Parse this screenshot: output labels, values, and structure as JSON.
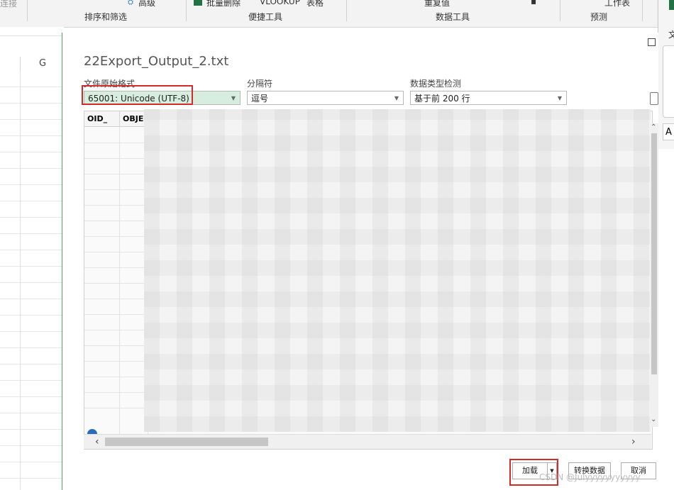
{
  "ribbon": {
    "frag_connect": "连接",
    "frag_advanced": "高级",
    "frag_batch_delete": "批量删除 ",
    "frag_vlookup": "VLOOKUP",
    "frag_table": "表格",
    "frag_reorg": "重复值",
    "frag_cut": "工作表",
    "group_sort_filter": "排序和筛选",
    "group_quick_tools": "便捷工具",
    "group_data_tools": "数据工具",
    "group_forecast": "预测"
  },
  "sheet": {
    "column_g": "G"
  },
  "dialog": {
    "title": "22Export_Output_2.txt",
    "file_origin_label": "文件原始格式",
    "file_origin_value": "65001: Unicode (UTF-8)",
    "delimiter_label": "分隔符",
    "delimiter_value": "逗号",
    "type_detect_label": "数据类型检测",
    "type_detect_value": "基于前 200 行",
    "columns": [
      "OID_",
      "OBJEC"
    ],
    "load_button": "加载",
    "transform_button": "转换数据",
    "cancel_button": "取消"
  },
  "right_panel": {
    "frag_letter": "A",
    "frag_wen": "文"
  },
  "watermark": "CSDN @Julyyyyyyyyyyy",
  "colors": {
    "accent_green": "#217346",
    "highlight_red": "#d42a2a",
    "selected_fill": "#d7eede"
  }
}
